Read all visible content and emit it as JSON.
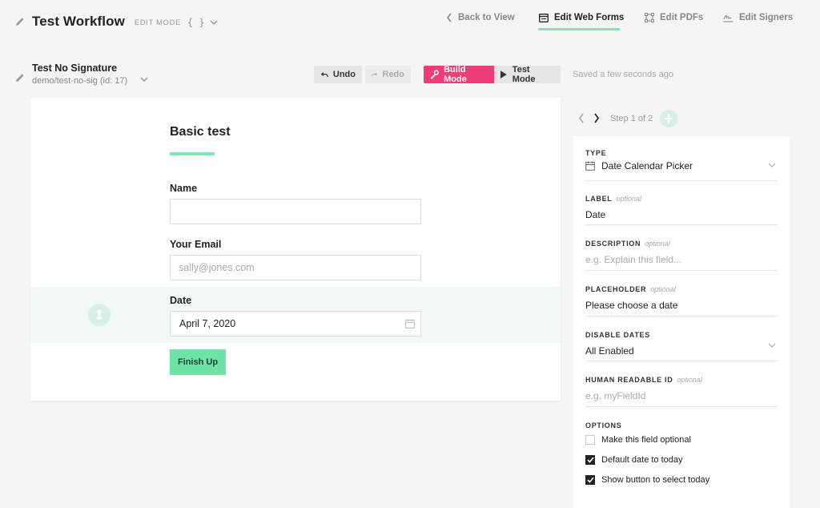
{
  "header": {
    "title": "Test Workflow",
    "mode": "EDIT MODE",
    "json_toggle": "{ }"
  },
  "nav": {
    "back": "Back to View",
    "web_forms": "Edit Web Forms",
    "pdfs": "Edit PDFs",
    "signers": "Edit Signers"
  },
  "document": {
    "title": "Test No Signature",
    "subtitle": "demo/test-no-sig (id: 17)"
  },
  "toolbar": {
    "undo": "Undo",
    "redo": "Redo",
    "build_mode": "Build Mode",
    "test_mode": "Test Mode",
    "saved": "Saved a few seconds ago"
  },
  "form": {
    "title": "Basic test",
    "fields": [
      {
        "label": "Name",
        "value": "",
        "placeholder": ""
      },
      {
        "label": "Your Email",
        "value": "",
        "placeholder": "sally@jones.com"
      },
      {
        "label": "Date",
        "value": "April 7, 2020",
        "placeholder": ""
      }
    ],
    "finish": "Finish Up"
  },
  "steps": {
    "text": "Step 1 of 2"
  },
  "panel": {
    "type": {
      "label": "TYPE",
      "value": "Date Calendar Picker"
    },
    "label": {
      "label": "LABEL",
      "optional": "optional",
      "value": "Date"
    },
    "description": {
      "label": "DESCRIPTION",
      "optional": "optional",
      "placeholder": "e.g. Explain this field..."
    },
    "placeholder": {
      "label": "PLACEHOLDER",
      "optional": "optional",
      "value": "Please choose a date"
    },
    "disable_dates": {
      "label": "DISABLE DATES",
      "value": "All Enabled"
    },
    "human_id": {
      "label": "HUMAN READABLE ID",
      "optional": "optional",
      "placeholder": "e.g. myFieldId"
    },
    "options": {
      "label": "OPTIONS",
      "items": [
        {
          "label": "Make this field optional",
          "checked": false
        },
        {
          "label": "Default date to today",
          "checked": true
        },
        {
          "label": "Show button to select today",
          "checked": true
        }
      ]
    }
  },
  "colors": {
    "accent_green": "#7ee6b0",
    "build_pink": "#ec3e74",
    "finish_green": "#6fe2a5"
  }
}
